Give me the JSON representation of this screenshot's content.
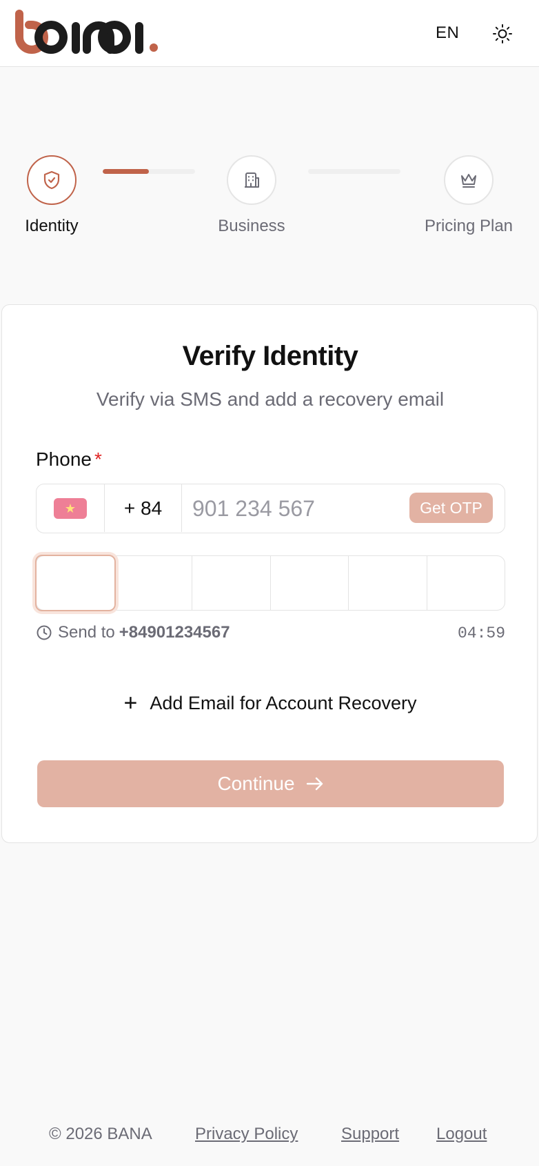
{
  "brand": {
    "name": "bana",
    "accent_color": "#c0634a",
    "dark_color": "#1c1c1c"
  },
  "header": {
    "language": "EN",
    "theme_icon": "sun-icon"
  },
  "stepper": {
    "steps": [
      {
        "label": "Identity",
        "icon": "shield-check-icon",
        "state": "active"
      },
      {
        "label": "Business",
        "icon": "building-icon",
        "state": "pending"
      },
      {
        "label": "Pricing Plan",
        "icon": "crown-icon",
        "state": "pending"
      }
    ],
    "connectors": [
      {
        "progress_percent": 50
      },
      {
        "progress_percent": 0
      }
    ]
  },
  "form": {
    "title": "Verify Identity",
    "subtitle": "Verify via SMS and add a recovery email",
    "phone_label": "Phone",
    "required_mark": "*",
    "country_flag": "★",
    "country_code": "+ 84",
    "phone_placeholder": "901 234 567",
    "phone_value": "",
    "get_otp_label": "Get OTP",
    "otp_length": 6,
    "otp_digits": [
      "",
      "",
      "",
      "",
      "",
      ""
    ],
    "send_to_prefix": "Send to",
    "send_to_number": "+84901234567",
    "timer": "04:59",
    "add_email_label": "Add Email for Account Recovery",
    "continue_label": "Continue",
    "button_disabled_color": "#e2b2a3"
  },
  "footer": {
    "copyright": "© 2026 BANA",
    "privacy": "Privacy Policy",
    "support": "Support",
    "logout": "Logout"
  }
}
